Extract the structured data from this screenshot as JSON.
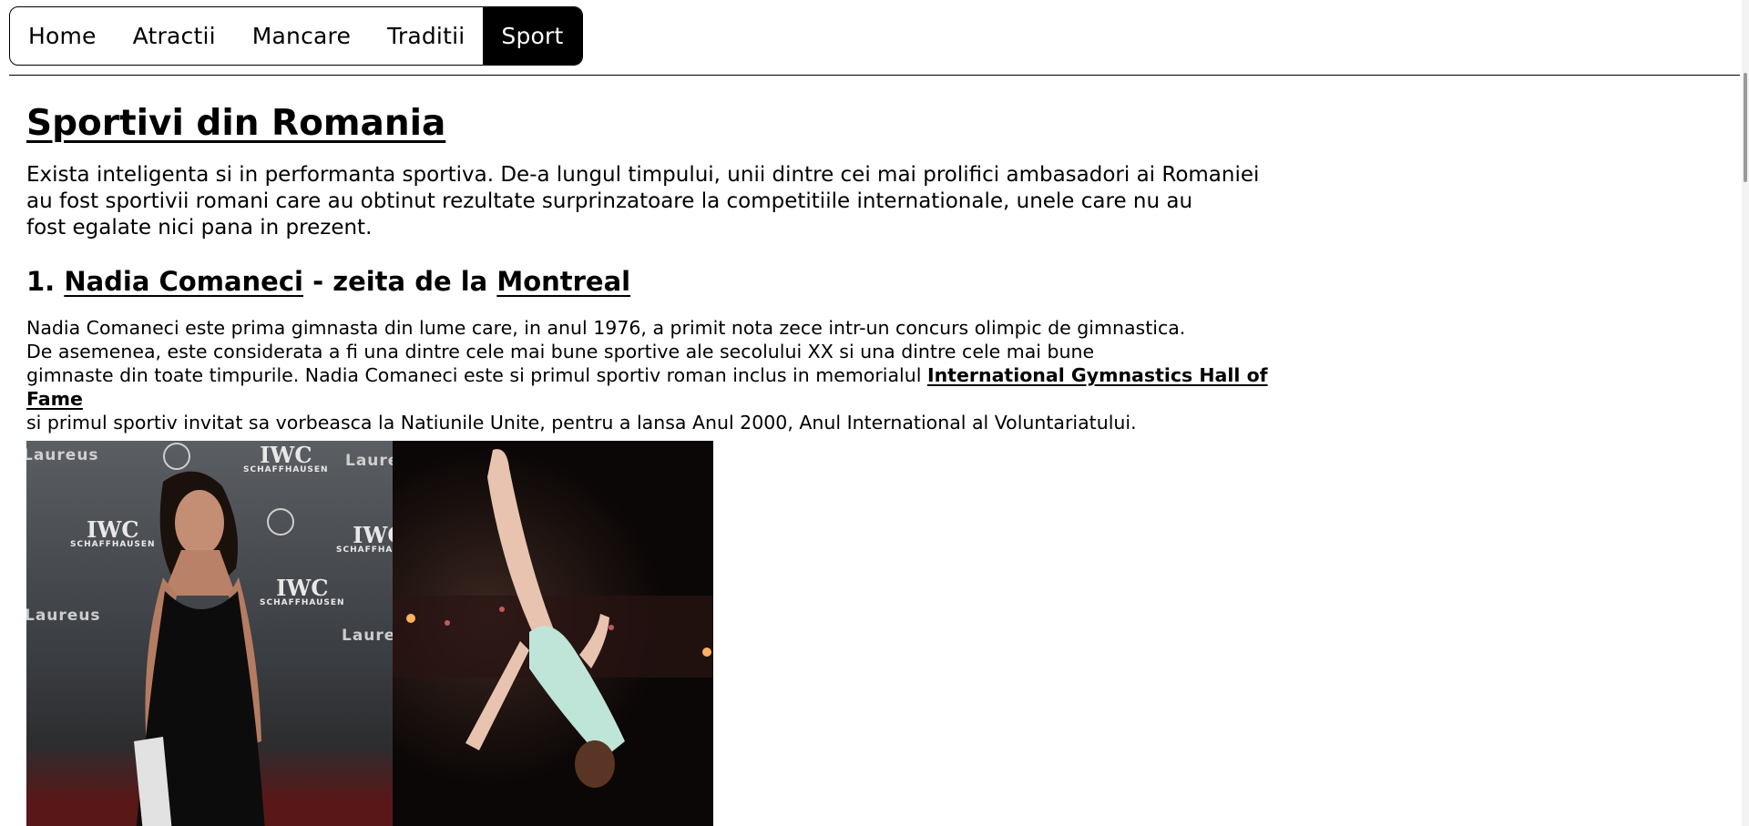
{
  "nav": {
    "items": [
      {
        "label": "Home",
        "active": false
      },
      {
        "label": "Atractii",
        "active": false
      },
      {
        "label": "Mancare",
        "active": false
      },
      {
        "label": "Traditii",
        "active": false
      },
      {
        "label": "Sport",
        "active": true
      }
    ]
  },
  "main": {
    "title": "Sportivi din Romania",
    "intro_lines": [
      "Exista inteligenta si in performanta sportiva. De-a lungul timpului, unii dintre cei mai prolifici ambasadori ai Romaniei",
      "au fost sportivii romani care au obtinut rezultate surprinzatoare la competitiile internationale, unele care nu au",
      "fost egalate nici pana in prezent."
    ],
    "section1": {
      "number": "1.",
      "name_link": "Nadia Comaneci",
      "separator": " - zeita de la ",
      "place_link": "Montreal",
      "bio_line1": "Nadia Comaneci este prima gimnasta din lume care, in anul 1976, a primit nota zece intr-un concurs olimpic de gimnastica.",
      "bio_line2": "De asemenea, este considerata a fi una dintre cele mai bune sportive ale secolului XX si una dintre cele mai bune",
      "bio_line3_start": "gimnaste din toate timpurile. Nadia Comaneci este si primul sportiv roman inclus in memorialul ",
      "bio_link": "International Gymnastics Hall of Fame",
      "bio_line4": "si primul sportiv invitat sa vorbeasca la Natiunile Unite, pentru a lansa Anul 2000, Anul International al Voluntariatului."
    },
    "photo1_logos": {
      "brand": "IWC",
      "brand_sub": "SCHAFFHAUSEN",
      "sponsor": "Laureus"
    }
  },
  "colors": {
    "text": "#000000",
    "background": "#ffffff",
    "nav_active_bg": "#000000",
    "nav_active_text": "#ffffff"
  }
}
